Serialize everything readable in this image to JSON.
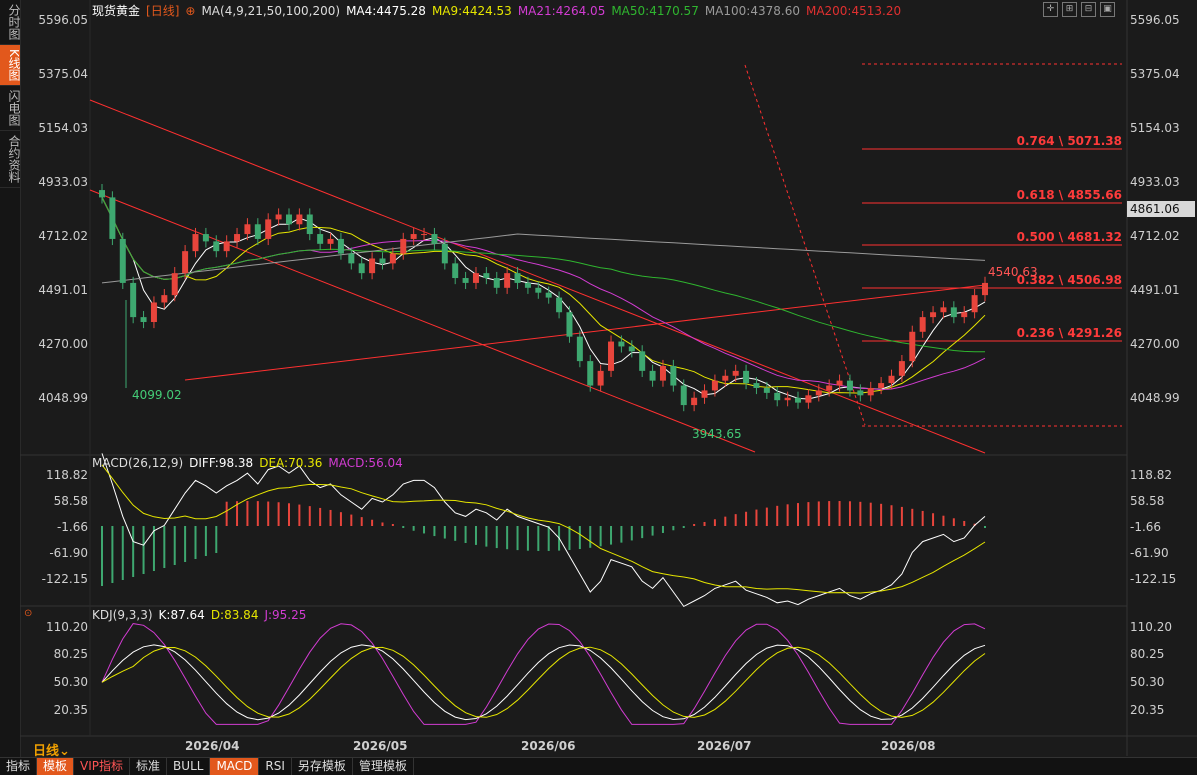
{
  "sidetabs": [
    "分时图",
    "K线图",
    "闪电图",
    "合约资料"
  ],
  "legend": {
    "title": "现货黄金",
    "period": "[日线]",
    "ma_label": "MA(4,9,21,50,100,200)",
    "ma4": "MA4:4475.28",
    "ma9": "MA9:4424.53",
    "ma21": "MA21:4264.05",
    "ma50": "MA50:4170.57",
    "ma100": "MA100:4378.60",
    "ma200": "MA200:4513.20"
  },
  "price_axis_left": [
    "5596.05",
    "5375.04",
    "5154.03",
    "4933.03",
    "4712.02",
    "4491.01",
    "4270.00",
    "4048.99"
  ],
  "price_axis_right": [
    "5596.05",
    "5375.04",
    "5154.03",
    "4933.03",
    "4712.02",
    "4491.01",
    "4270.00",
    "4048.99"
  ],
  "last_price": "4861.06",
  "annotations": {
    "low1": "4099.02",
    "low2": "3943.65",
    "high": "4540.63",
    "fib": [
      "0.764 \\ 5071.38",
      "0.618 \\ 4855.66",
      "0.500 \\ 4681.32",
      "0.382 \\ 4506.98",
      "0.236 \\ 4291.26"
    ]
  },
  "macd_legend": {
    "label": "MACD(26,12,9)",
    "diff": "DIFF:98.38",
    "dea": "DEA:70.36",
    "macd": "MACD:56.04"
  },
  "macd_axis": [
    "118.82",
    "58.58",
    "-1.66",
    "-61.90",
    "-122.15"
  ],
  "kdj_legend": {
    "label": "KDJ(9,3,3)",
    "k": "K:87.64",
    "d": "D:83.84",
    "j": "J:95.25"
  },
  "kdj_axis": [
    "110.20",
    "80.25",
    "50.30",
    "20.35"
  ],
  "dates": [
    "2026/04",
    "2026/05",
    "2026/06",
    "2026/07",
    "2026/08"
  ],
  "period_selector": "日线",
  "bottombar": [
    "指标",
    "模板",
    "VIP指标",
    "标准",
    "BULL",
    "MACD",
    "RSI",
    "另存模板",
    "管理模板"
  ],
  "colors": {
    "up": "#e8453c",
    "down": "#3ea870",
    "ma4": "#ffffff",
    "ma9": "#e6e600",
    "ma21": "#d23cd2",
    "ma50": "#2fb52f",
    "ma100": "#9a9a9a",
    "ma200": "#e03030",
    "fib": "#ff3030"
  },
  "chart_data": {
    "type": "candlestick",
    "ylim": [
      3943.65,
      5596.05
    ],
    "closes": [
      4870,
      4700,
      4520,
      4380,
      4360,
      4440,
      4470,
      4560,
      4650,
      4720,
      4690,
      4650,
      4690,
      4720,
      4760,
      4700,
      4780,
      4800,
      4760,
      4800,
      4720,
      4680,
      4700,
      4640,
      4600,
      4560,
      4620,
      4600,
      4640,
      4700,
      4720,
      4720,
      4680,
      4600,
      4540,
      4520,
      4560,
      4540,
      4500,
      4560,
      4520,
      4500,
      4480,
      4460,
      4400,
      4300,
      4200,
      4100,
      4160,
      4280,
      4260,
      4240,
      4160,
      4120,
      4180,
      4100,
      4020,
      4050,
      4080,
      4120,
      4140,
      4160,
      4110,
      4090,
      4070,
      4040,
      4050,
      4030,
      4060,
      4080,
      4100,
      4120,
      4080,
      4060,
      4090,
      4110,
      4140,
      4200,
      4320,
      4380,
      4400,
      4420,
      4380,
      4400,
      4470,
      4520
    ]
  }
}
